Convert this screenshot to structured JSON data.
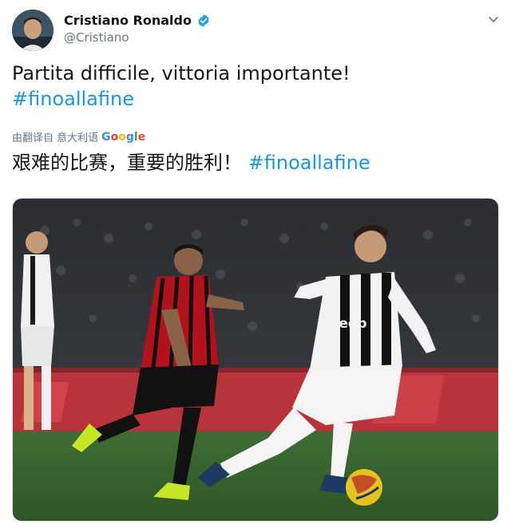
{
  "author": {
    "name": "Cristiano Ronaldo",
    "handle": "@Cristiano",
    "verified": true
  },
  "tweet": {
    "text": "Partita difficile, vittoria importante!",
    "hashtag": "#finoallafine"
  },
  "translation": {
    "label": "由翻译自 意大利语",
    "provider": "Google",
    "text": "艰难的比赛，重要的胜利！",
    "hashtag": "#finoallafine"
  },
  "media": {
    "jersey_text": "Jeep"
  },
  "icons": {
    "verified": "verified-badge-icon",
    "menu": "chevron-down-icon"
  },
  "colors": {
    "link": "#1b95e0",
    "verified": "#1da1f2",
    "secondary_text": "#657786"
  }
}
